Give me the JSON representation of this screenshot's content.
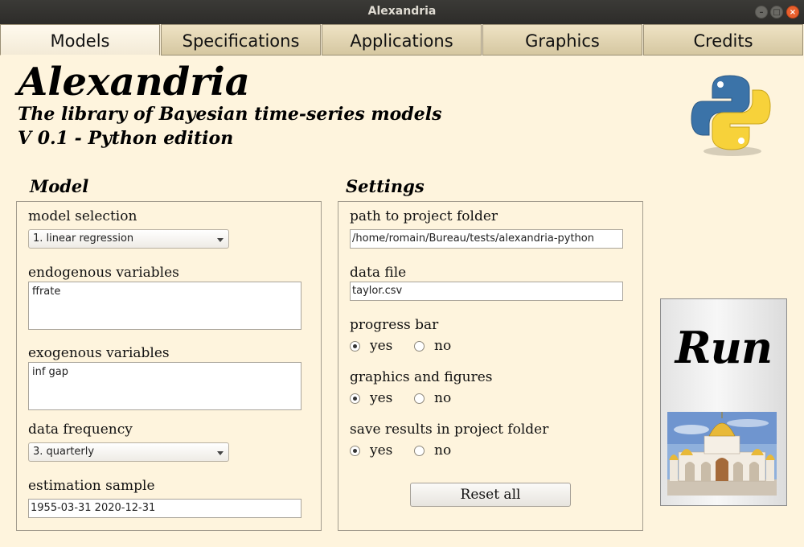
{
  "window": {
    "title": "Alexandria",
    "minimize_icon": "minimize-icon",
    "maximize_icon": "maximize-icon",
    "close_icon": "close-icon"
  },
  "tabs": [
    {
      "label": "Models",
      "active": true
    },
    {
      "label": "Specifications",
      "active": false
    },
    {
      "label": "Applications",
      "active": false
    },
    {
      "label": "Graphics",
      "active": false
    },
    {
      "label": "Credits",
      "active": false
    }
  ],
  "header": {
    "title": "Alexandria",
    "subtitle": "The library of Bayesian time-series models",
    "version": "V 0.1 - Python edition",
    "logo": "python-logo"
  },
  "model": {
    "section_title": "Model",
    "model_selection": {
      "label": "model selection",
      "value": "1. linear regression"
    },
    "endogenous": {
      "label": "endogenous variables",
      "value": "ffrate"
    },
    "exogenous": {
      "label": "exogenous variables",
      "value": "inf gap"
    },
    "frequency": {
      "label": "data frequency",
      "value": "3. quarterly"
    },
    "sample": {
      "label": "estimation sample",
      "value": "1955-03-31 2020-12-31"
    }
  },
  "settings": {
    "section_title": "Settings",
    "project_path": {
      "label": "path to project folder",
      "value": "/home/romain/Bureau/tests/alexandria-python"
    },
    "data_file": {
      "label": "data file",
      "value": "taylor.csv"
    },
    "progress_bar": {
      "label": "progress bar",
      "yes": "yes",
      "no": "no",
      "selected": "yes"
    },
    "graphics": {
      "label": "graphics and figures",
      "yes": "yes",
      "no": "no",
      "selected": "yes"
    },
    "save_results": {
      "label": "save results in project folder",
      "yes": "yes",
      "no": "no",
      "selected": "yes"
    },
    "reset_label": "Reset all"
  },
  "run": {
    "label": "Run",
    "image": "cathedral-image"
  },
  "colors": {
    "background": "#fef4dd",
    "titlebar": "#3b3a37",
    "tab": "#d5c7a1",
    "close": "#e9602d"
  }
}
